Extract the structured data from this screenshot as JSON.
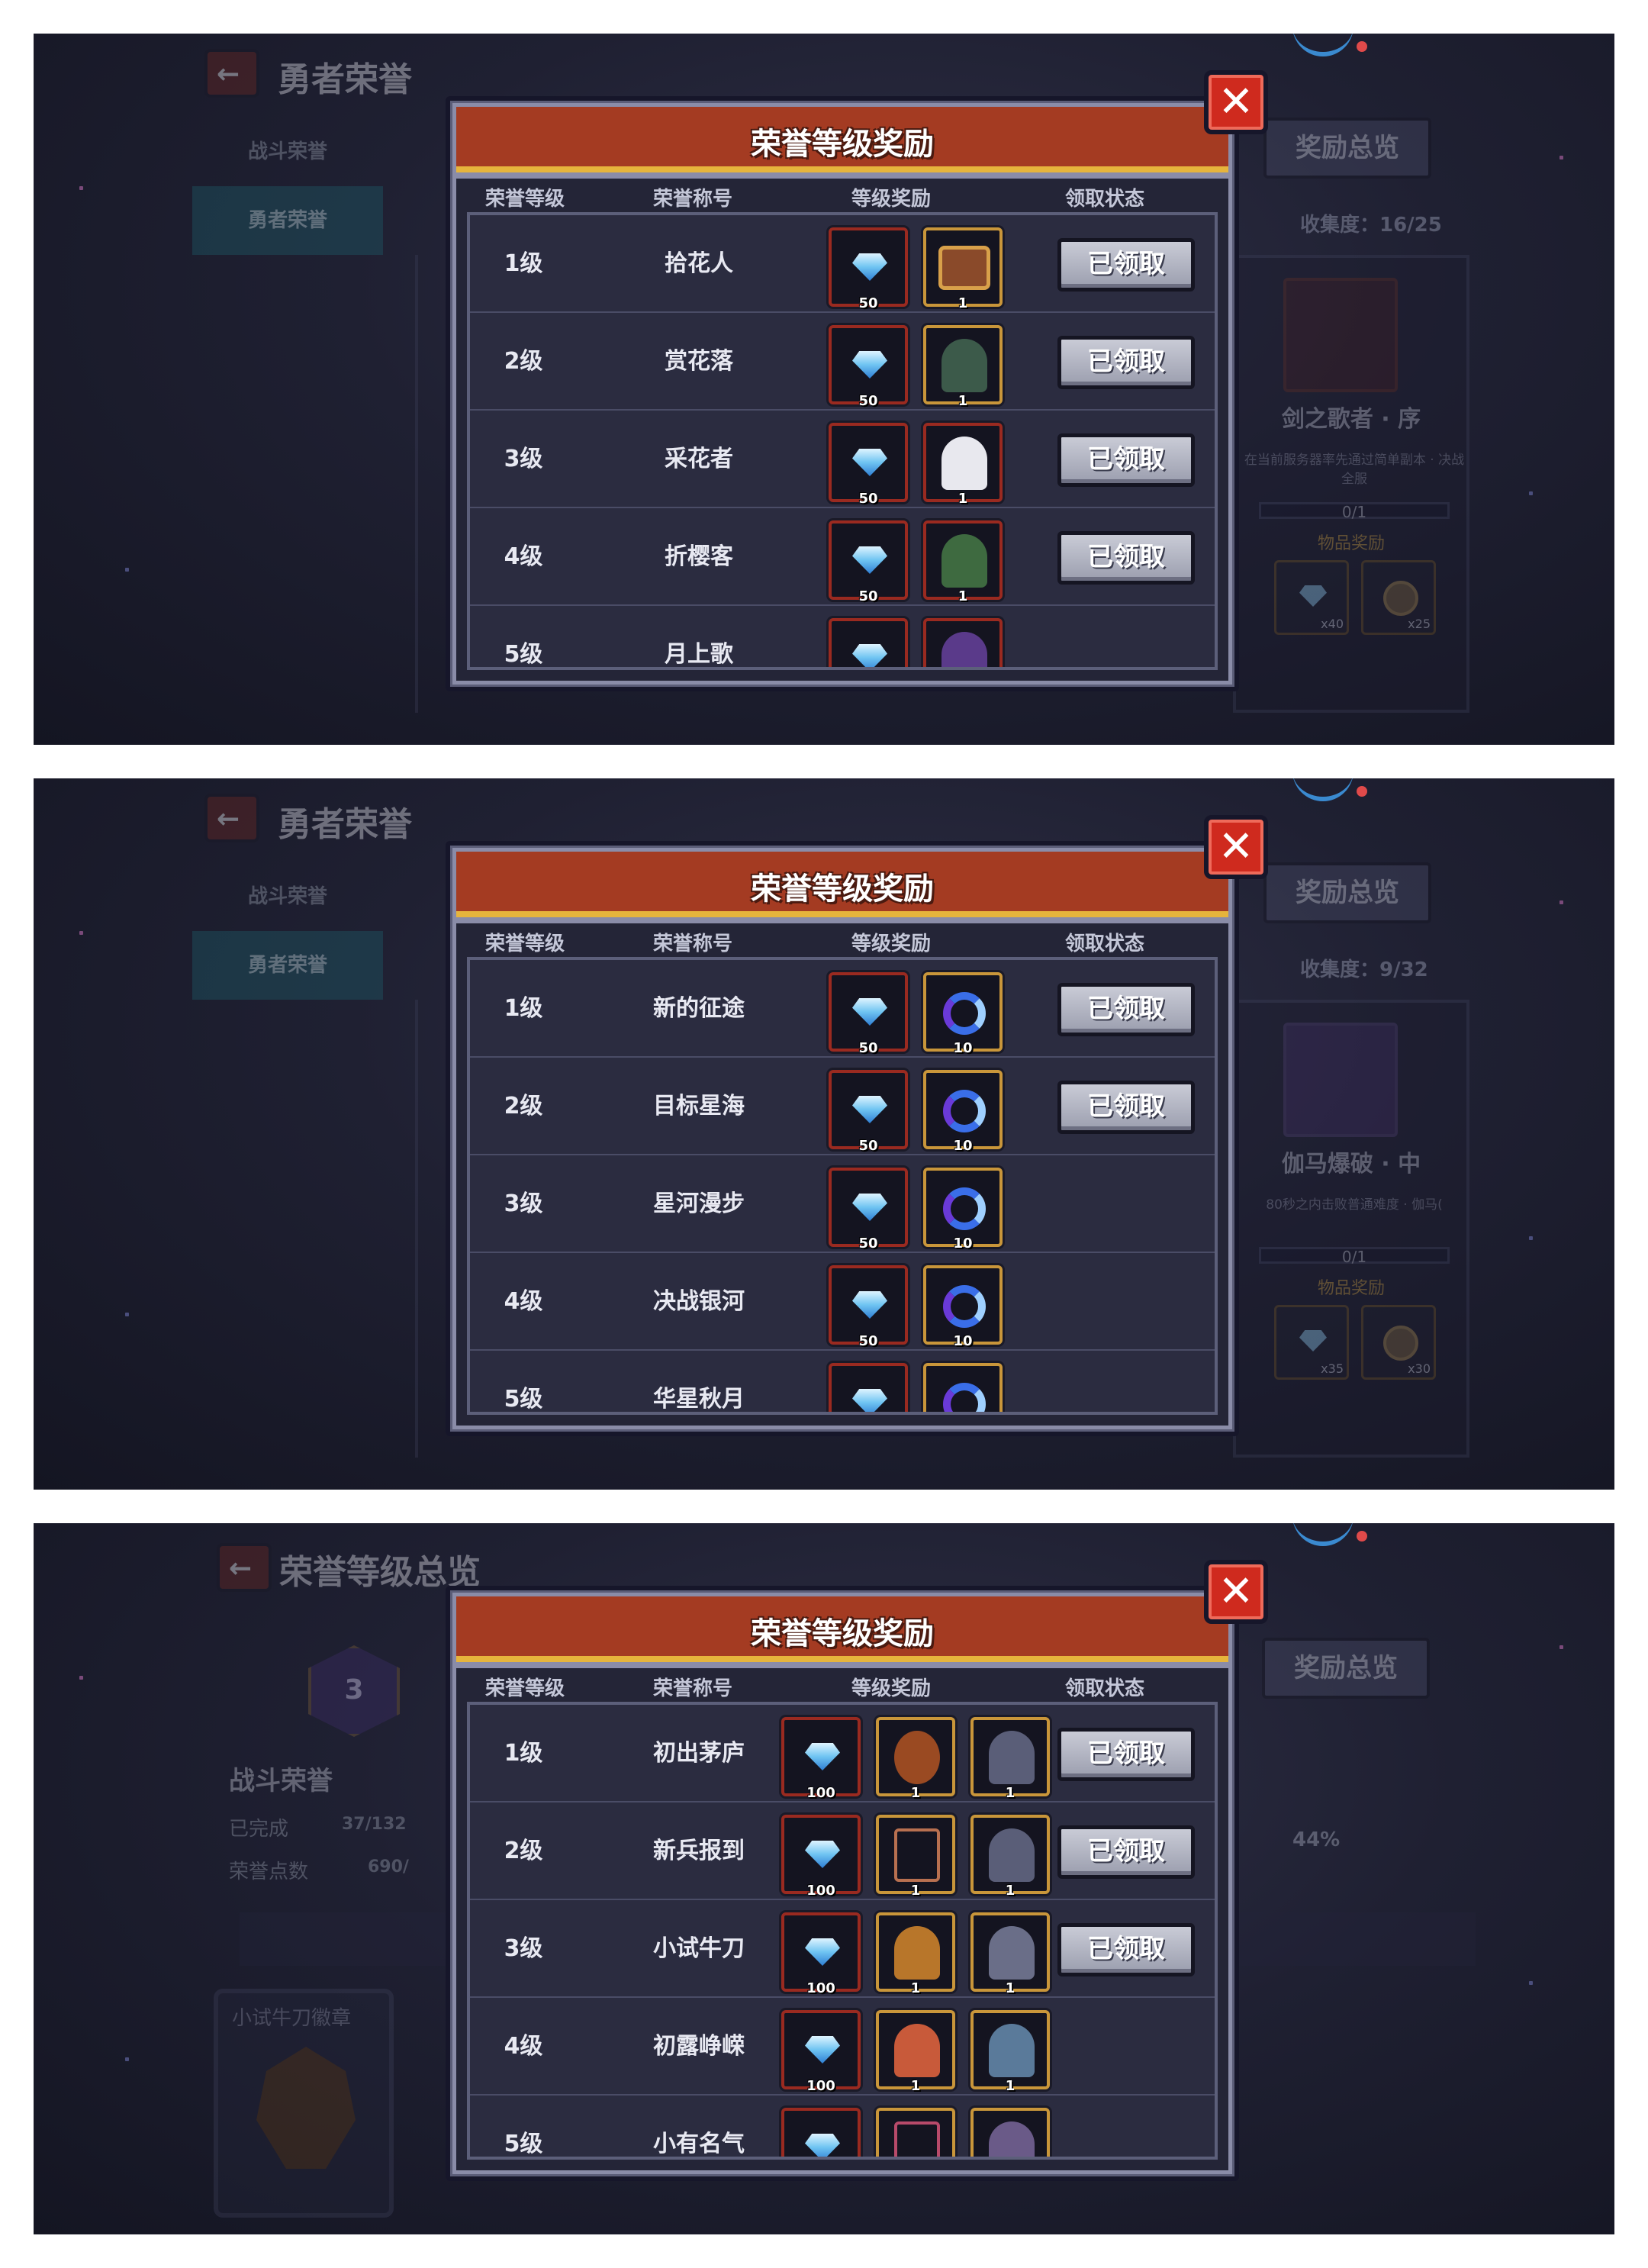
{
  "panels": [
    {
      "id": "p1",
      "background": {
        "title": "勇者荣誉",
        "tabs": [
          "战斗荣誉",
          "勇者荣誉"
        ],
        "overview_button": "奖励总览",
        "collection": "收集度：16/25",
        "side_card": {
          "name": "剑之歌者 · 序",
          "desc": "在当前服务器率先通过简单副本 · 决战全服",
          "progress": "0/1",
          "reward_label": "物品奖励",
          "items": [
            {
              "icon": "gem-icon",
              "count": "x40"
            },
            {
              "icon": "coin-icon",
              "count": "x25"
            }
          ]
        }
      },
      "dialog": {
        "title": "荣誉等级奖励",
        "columns": [
          "荣誉等级",
          "荣誉称号",
          "等级奖励",
          "领取状态"
        ],
        "rows": [
          {
            "level": "1级",
            "title": "拾花人",
            "rewards": [
              {
                "icon": "gem-icon",
                "qty": "50"
              },
              {
                "icon": "chest-icon",
                "qty": "1"
              }
            ],
            "status": "已领取"
          },
          {
            "level": "2级",
            "title": "赏花落",
            "rewards": [
              {
                "icon": "gem-icon",
                "qty": "50"
              },
              {
                "icon": "character-icon",
                "qty": "1"
              }
            ],
            "status": "已领取"
          },
          {
            "level": "3级",
            "title": "采花者",
            "rewards": [
              {
                "icon": "gem-icon",
                "qty": "50"
              },
              {
                "icon": "character-icon",
                "qty": "1"
              }
            ],
            "status": "已领取"
          },
          {
            "level": "4级",
            "title": "折樱客",
            "rewards": [
              {
                "icon": "gem-icon",
                "qty": "50"
              },
              {
                "icon": "character-icon",
                "qty": "1"
              }
            ],
            "status": "已领取"
          },
          {
            "level": "5级",
            "title": "月上歌",
            "rewards": [
              {
                "icon": "gem-icon",
                "qty": ""
              },
              {
                "icon": "character-icon",
                "qty": ""
              }
            ],
            "status": ""
          }
        ]
      }
    },
    {
      "id": "p2",
      "background": {
        "title": "勇者荣誉",
        "tabs": [
          "战斗荣誉",
          "勇者荣誉"
        ],
        "overview_button": "奖励总览",
        "collection": "收集度：9/32",
        "side_card": {
          "name": "伽马爆破 · 中",
          "desc": "80秒之内击败普通难度 · 伽马(",
          "progress": "0/1",
          "reward_label": "物品奖励",
          "items": [
            {
              "icon": "gem-icon",
              "count": "x35"
            },
            {
              "icon": "coin-icon",
              "count": "x30"
            }
          ]
        }
      },
      "dialog": {
        "title": "荣誉等级奖励",
        "columns": [
          "荣誉等级",
          "荣誉称号",
          "等级奖励",
          "领取状态"
        ],
        "rows": [
          {
            "level": "1级",
            "title": "新的征途",
            "rewards": [
              {
                "icon": "gem-icon",
                "qty": "50"
              },
              {
                "icon": "swirl-icon",
                "qty": "10"
              }
            ],
            "status": "已领取"
          },
          {
            "level": "2级",
            "title": "目标星海",
            "rewards": [
              {
                "icon": "gem-icon",
                "qty": "50"
              },
              {
                "icon": "swirl-icon",
                "qty": "10"
              }
            ],
            "status": "已领取"
          },
          {
            "level": "3级",
            "title": "星河漫步",
            "rewards": [
              {
                "icon": "gem-icon",
                "qty": "50"
              },
              {
                "icon": "swirl-icon",
                "qty": "10"
              }
            ],
            "status": ""
          },
          {
            "level": "4级",
            "title": "决战银河",
            "rewards": [
              {
                "icon": "gem-icon",
                "qty": "50"
              },
              {
                "icon": "swirl-icon",
                "qty": "10"
              }
            ],
            "status": ""
          },
          {
            "level": "5级",
            "title": "华星秋月",
            "rewards": [
              {
                "icon": "gem-icon",
                "qty": ""
              },
              {
                "icon": "swirl-icon",
                "qty": ""
              }
            ],
            "status": ""
          }
        ]
      }
    },
    {
      "id": "p3",
      "background": {
        "title": "荣誉等级总览",
        "rank_badge": "3",
        "section": "战斗荣誉",
        "completed_label": "已完成",
        "completed_value": "37/132",
        "points_label": "荣誉点数",
        "points_value": "690/",
        "percent": "44%",
        "badge_card": "小试牛刀徽章",
        "overview_button": "奖励总览"
      },
      "dialog": {
        "title": "荣誉等级奖励",
        "columns": [
          "荣誉等级",
          "荣誉称号",
          "等级奖励",
          "领取状态"
        ],
        "rows": [
          {
            "level": "1级",
            "title": "初出茅庐",
            "rewards": [
              {
                "icon": "gem-icon",
                "qty": "100"
              },
              {
                "icon": "mask-icon",
                "qty": "1"
              },
              {
                "icon": "spider-icon",
                "qty": "1"
              }
            ],
            "status": "已领取"
          },
          {
            "level": "2级",
            "title": "新兵报到",
            "rewards": [
              {
                "icon": "gem-icon",
                "qty": "100"
              },
              {
                "icon": "frame-icon",
                "qty": "1"
              },
              {
                "icon": "spider-icon",
                "qty": "1"
              }
            ],
            "status": "已领取"
          },
          {
            "level": "3级",
            "title": "小试牛刀",
            "rewards": [
              {
                "icon": "gem-icon",
                "qty": "100"
              },
              {
                "icon": "mask-icon",
                "qty": "1"
              },
              {
                "icon": "spider-icon",
                "qty": "1"
              }
            ],
            "status": "已领取"
          },
          {
            "level": "4级",
            "title": "初露峥嵘",
            "rewards": [
              {
                "icon": "gem-icon",
                "qty": "100"
              },
              {
                "icon": "mask-icon",
                "qty": "1"
              },
              {
                "icon": "spider-icon",
                "qty": "1"
              }
            ],
            "status": ""
          },
          {
            "level": "5级",
            "title": "小有名气",
            "rewards": [
              {
                "icon": "gem-icon",
                "qty": ""
              },
              {
                "icon": "frame-icon",
                "qty": ""
              },
              {
                "icon": "spider-icon",
                "qty": ""
              }
            ],
            "status": ""
          }
        ]
      }
    }
  ],
  "colors": {
    "header_red": "#a43b22",
    "header_gold": "#e6b43c",
    "gem_blue": "#6fc4f2",
    "slot_red": "#9a2a20",
    "slot_gold": "#c9963a"
  }
}
